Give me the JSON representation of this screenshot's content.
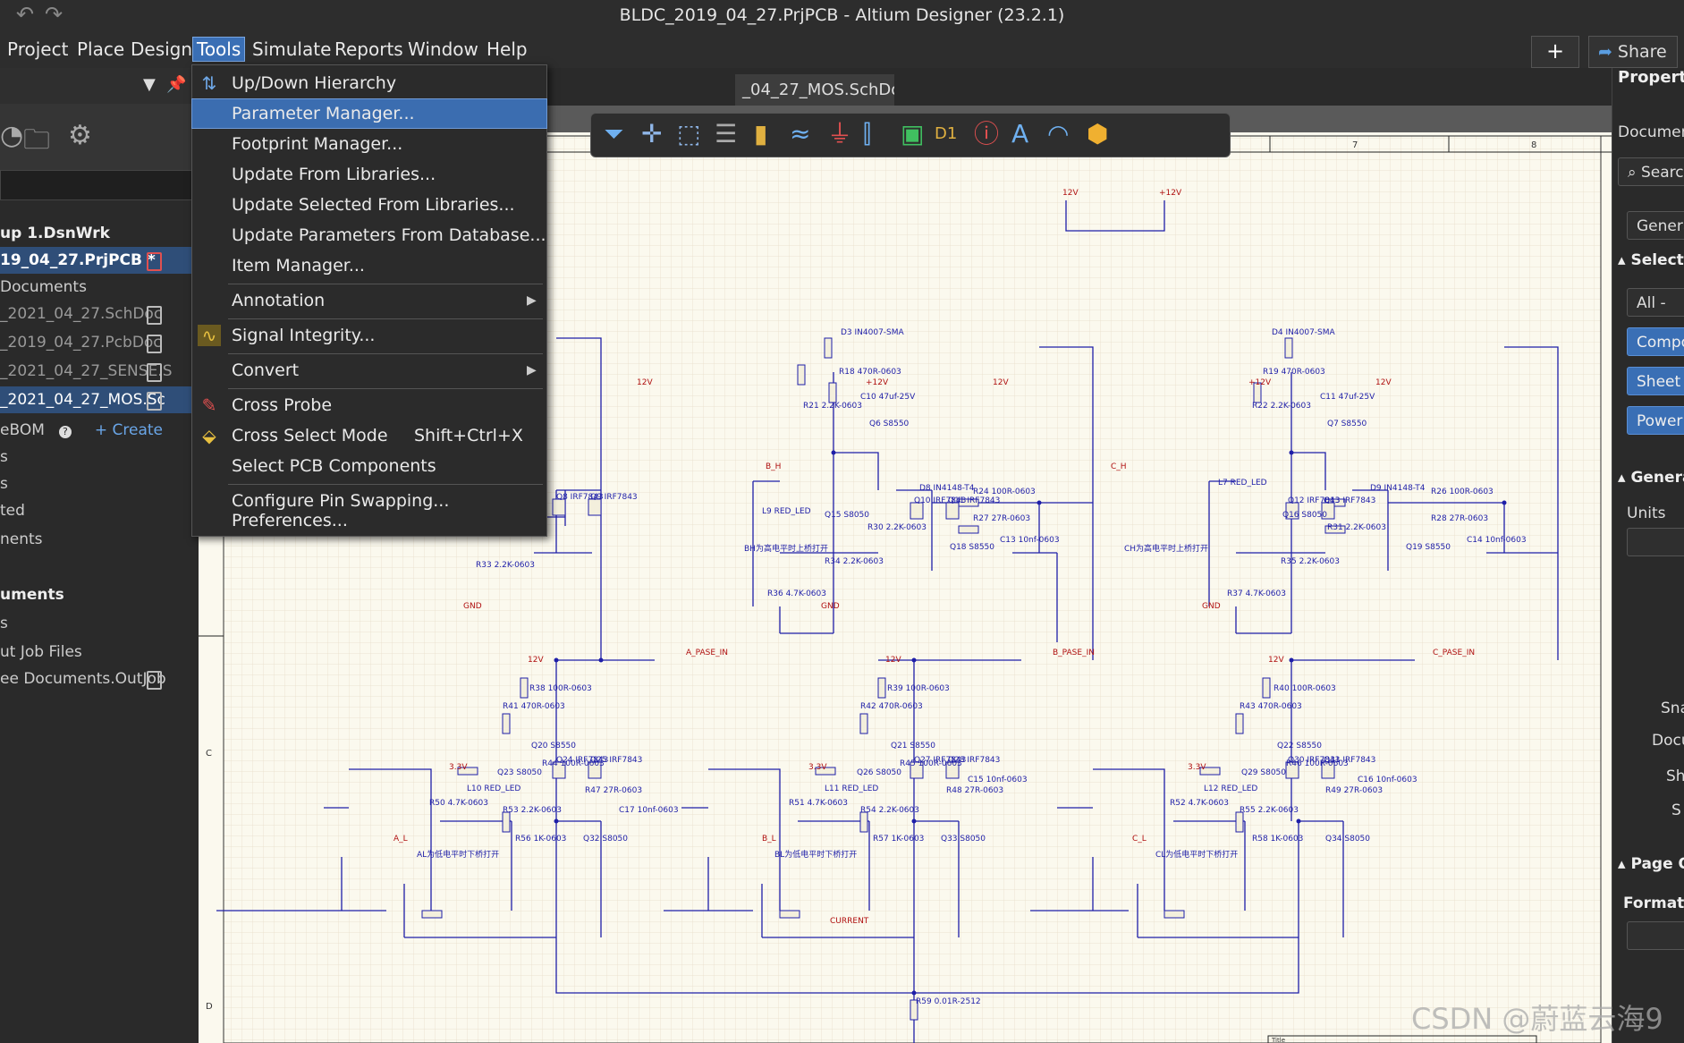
{
  "window": {
    "title": "BLDC_2019_04_27.PrjPCB - Altium Designer (23.2.1)",
    "undo_icon": "↶",
    "redo_icon": "↷"
  },
  "menubar": {
    "items": [
      "Project",
      "Place",
      "Design",
      "Tools",
      "Simulate",
      "Reports",
      "Window",
      "Help"
    ],
    "active": "Tools",
    "share_label": "Share",
    "plus_icon": "+"
  },
  "tools_menu": {
    "items": [
      {
        "label": "Up/Down Hierarchy",
        "icon": "updown-hierarchy-icon"
      },
      {
        "label": "Parameter Manager...",
        "highlighted": true
      },
      {
        "label": "Footprint Manager..."
      },
      {
        "label": "Update From Libraries..."
      },
      {
        "label": "Update Selected From Libraries..."
      },
      {
        "label": "Update Parameters From Database..."
      },
      {
        "label": "Item Manager..."
      },
      {
        "label": "Annotation",
        "submenu": true
      },
      {
        "label": "Signal Integrity...",
        "icon": "signal-integrity-icon"
      },
      {
        "label": "Convert",
        "submenu": true
      },
      {
        "label": "Cross Probe",
        "icon": "cross-probe-icon"
      },
      {
        "label": "Cross Select Mode",
        "shortcut": "Shift+Ctrl+X",
        "icon": "cross-select-icon"
      },
      {
        "label": "Select PCB Components"
      },
      {
        "label": "Configure Pin Swapping..."
      },
      {
        "label": "Preferences..."
      }
    ]
  },
  "left_panel": {
    "rows": [
      {
        "text": "up 1.DsnWrk",
        "style": "bold"
      },
      {
        "text": "19_04_27.PrjPCB *",
        "style": "bold-sel",
        "icon": "doc-red"
      },
      {
        "text": "Documents",
        "style": "normal"
      },
      {
        "text": "_2021_04_27.SchDoc",
        "style": "dim",
        "icon": "doc"
      },
      {
        "text": "_2019_04_27.PcbDoc",
        "style": "dim",
        "icon": "doc"
      },
      {
        "text": "_2021_04_27_SENSE.S",
        "style": "dim",
        "icon": "doc"
      },
      {
        "text": "_2021_04_27_MOS.Sc",
        "style": "sel",
        "icon": "doc"
      },
      {
        "text": "eBOM",
        "style": "normal",
        "help": "?",
        "create": "+ Create"
      },
      {
        "text": "s",
        "style": "normal"
      },
      {
        "text": "s",
        "style": "normal"
      },
      {
        "text": "ted",
        "style": "normal"
      },
      {
        "text": "nents",
        "style": "normal"
      },
      {
        "text": "uments",
        "style": "bold"
      },
      {
        "text": "s",
        "style": "normal"
      },
      {
        "text": "ut Job Files",
        "style": "normal"
      },
      {
        "text": "ee Documents.OutJob",
        "style": "normal",
        "icon": "doc"
      }
    ]
  },
  "document_tab": {
    "label": "_04_27_MOS.SchDoc"
  },
  "schematic": {
    "ruler_numbers": [
      "7",
      "8"
    ],
    "row_letters": [
      "C",
      "D"
    ],
    "rails": [
      "12V",
      "+12V",
      "+12V",
      "12V",
      "+12V",
      "12V",
      "12V",
      "12V",
      "12V"
    ],
    "phase_nets": [
      "A_PASE_IN",
      "B_PASE_IN",
      "C_PASE_IN"
    ],
    "input_nets": [
      "B_H",
      "C_H",
      "A_L",
      "B_L",
      "C_L",
      "3.3V",
      "3.3V",
      "3.3V"
    ],
    "ground": "GND",
    "current_net": "CURRENT",
    "parts": [
      "D3 IN4007-SMA",
      "D4 IN4007-SMA",
      "R18 470R-0603",
      "R19 470R-0603",
      "C10 47uf-25V",
      "C11 47uf-25V",
      "R21 2.2K-0603",
      "R22 2.2K-0603",
      "Q6 S8550",
      "Q7 S8550",
      "D8 IN4148-T4",
      "D9 IN4148-T4",
      "R24 100R-0603",
      "R26 100R-0603",
      "R27 27R-0603",
      "R28 27R-0603",
      "Q8 IRF7843",
      "Q9 IRF7843",
      "Q10 IRF7843",
      "Q11 IRF7843",
      "Q12 IRF7843",
      "Q13 IRF7843",
      "L9 RED_LED",
      "L7 RED_LED",
      "Q15 S8050",
      "Q16 S8050",
      "R30 2.2K-0603",
      "R31 2.2K-0603",
      "Q18 S8550",
      "Q19 S8550",
      "C13 10nf-0603",
      "C14 10nf-0603",
      "R34 2.2K-0603",
      "R35 2.2K-0603",
      "R36 4.7K-0603",
      "R37 4.7K-0603",
      "R33 2.2K-0603",
      "R38 100R-0603",
      "R39 100R-0603",
      "R40 100R-0603",
      "R41 470R-0603",
      "R42 470R-0603",
      "R43 470R-0603",
      "Q20 S8550",
      "Q21 S8550",
      "Q22 S8550",
      "Q23 S8050",
      "Q26 S8050",
      "Q29 S8050",
      "R44 100R-0603",
      "R45 100R-0603",
      "R46 100R-0603",
      "Q24 IRF7843",
      "Q25 IRF7843",
      "Q27 IRF7843",
      "Q28 IRF7843",
      "Q30 IRF7843",
      "Q31 IRF7843",
      "L10 RED_LED",
      "L11 RED_LED",
      "L12 RED_LED",
      "R47 27R-0603",
      "R48 27R-0603",
      "R49 27R-0603",
      "C15 10nf-0603",
      "C16 10nf-0603",
      "C17 10nf-0603",
      "R50 4.7K-0603",
      "R51 4.7K-0603",
      "R52 4.7K-0603",
      "R53 2.2K-0603",
      "R54 2.2K-0603",
      "R55 2.2K-0603",
      "R56 1K-0603",
      "R57 1K-0603",
      "R58 1K-0603",
      "Q32 S8050",
      "Q33 S8050",
      "Q34 S8050",
      "R59 0.01R-2512"
    ],
    "notes": [
      "BH为高电平时上桥打开",
      "CH为高电平时上桥打开",
      "AL为低电平时下桥打开",
      "BL为低电平时下桥打开",
      "CL为低电平时下桥打开"
    ],
    "title_block": "Title"
  },
  "right_panel": {
    "header": "Properties",
    "document_label": "Document",
    "search_placeholder": "Search",
    "general_tab": "General",
    "selection_header": "Selection",
    "all_btn": "All -",
    "component_btn": "Compo",
    "sheet_btn": "Sheet",
    "power_btn": "Power",
    "general_header": "General",
    "units_label": "Units",
    "snap_label": "Sna",
    "docu_label": "Docu",
    "sh_label": "Sh",
    "s_label": "S",
    "page_options_header": "Page Op",
    "formatting_label": "Formatti",
    "t_btn": "T"
  },
  "watermark": "CSDN @蔚蓝云海9",
  "colors": {
    "wire": "#1e1ea8",
    "net_red": "#b01010",
    "highlight": "#3b6db0"
  }
}
